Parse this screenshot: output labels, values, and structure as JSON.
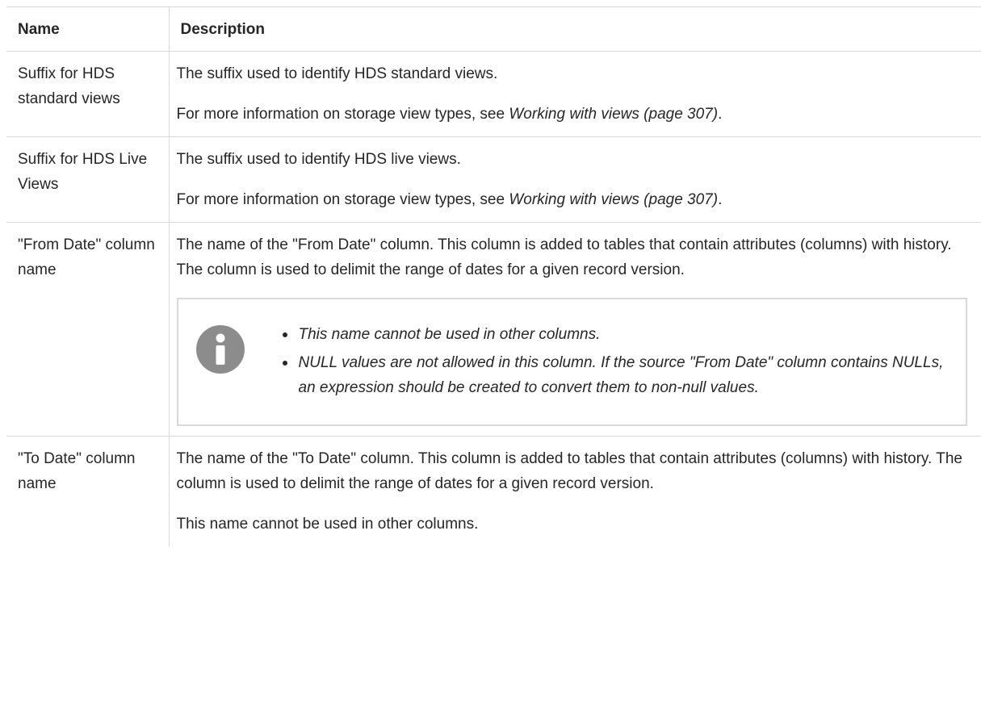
{
  "table": {
    "headers": {
      "name": "Name",
      "description": "Description"
    },
    "rows": [
      {
        "name": "Suffix for HDS standard views",
        "desc1": "The suffix used to identify HDS standard views.",
        "desc2_prefix": "For more information on storage view types, see ",
        "desc2_link": "Working with views (page 307)",
        "desc2_suffix": "."
      },
      {
        "name": "Suffix for HDS Live Views",
        "desc1": "The suffix used to identify HDS live views.",
        "desc2_prefix": "For more information on storage view types, see ",
        "desc2_link": "Working with views (page 307)",
        "desc2_suffix": "."
      },
      {
        "name": "\"From Date\" column name",
        "desc1": "The name of the \"From Date\" column. This column is added to tables that contain attributes (columns) with history. The column is used to delimit the range of dates for a given record version.",
        "note": {
          "icon": "info-icon",
          "items": [
            "This name cannot be used in other columns.",
            "NULL values are not allowed in this column. If the source \"From Date\" column contains NULLs, an expression should be created to convert them to non-null values."
          ]
        }
      },
      {
        "name": "\"To Date\" column name",
        "desc1": "The name of the \"To Date\" column. This column is added to tables that contain attributes (columns) with history. The column is used to delimit the range of dates for a given record version.",
        "desc2": "This name cannot be used in other columns."
      }
    ]
  },
  "colors": {
    "text": "#262626",
    "border": "#d9d9d9",
    "info_icon": "#8c8c8c"
  }
}
